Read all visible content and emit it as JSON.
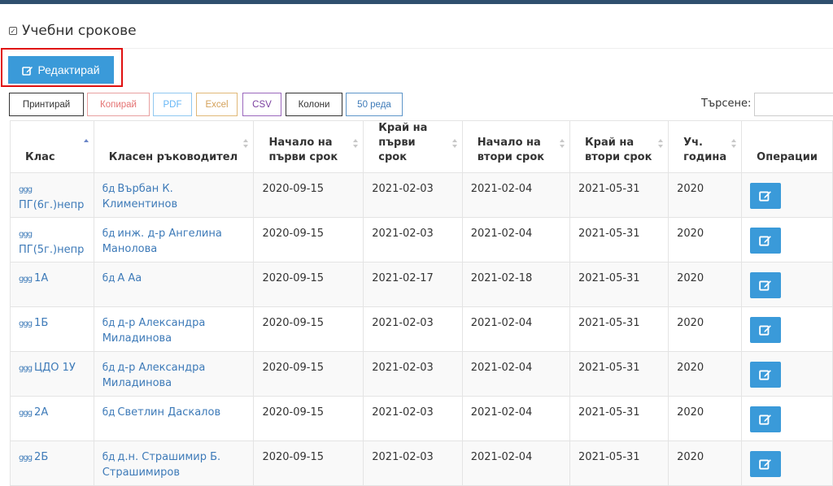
{
  "page_title": "Учебни срокове",
  "edit_button_label": "Редактирай",
  "exports": [
    {
      "label": "Принтирай",
      "color": "#333333",
      "border": "#333333"
    },
    {
      "label": "Копирай",
      "color": "#e57373",
      "border": "#e8a0a0"
    },
    {
      "label": "PDF",
      "color": "#64b5f6",
      "border": "#90c8f0"
    },
    {
      "label": "Excel",
      "color": "#d4a15a",
      "border": "#e0b878"
    },
    {
      "label": "CSV",
      "color": "#7b3fa0",
      "border": "#9b67bd"
    },
    {
      "label": "Колони",
      "color": "#333333",
      "border": "#333333"
    },
    {
      "label": "50 реда",
      "color": "#3d7ab8",
      "border": "#5d95c9"
    }
  ],
  "search": {
    "label": "Търсене:",
    "value": "",
    "placeholder": ""
  },
  "table": {
    "headers": [
      {
        "l1": "",
        "l2": "Клас",
        "sort": "asc"
      },
      {
        "l1": "",
        "l2": "Класен ръководител",
        "sort": "both"
      },
      {
        "l1": "Начало на",
        "l2": "първи срок",
        "sort": "both"
      },
      {
        "l1": "Край на",
        "l2": "първи срок",
        "sort": "both"
      },
      {
        "l1": "Начало на",
        "l2": "втори срок",
        "sort": "both"
      },
      {
        "l1": "Край на",
        "l2": "втори срок",
        "sort": "both"
      },
      {
        "l1": "Уч.",
        "l2": "година",
        "sort": "both"
      },
      {
        "l1": "",
        "l2": "Операции",
        "sort": "none"
      }
    ],
    "rows": [
      {
        "cls": "ПГ(6г.)непр",
        "teacher": "Върбан К. Климентинов",
        "s1_start": "2020-09-15",
        "s1_end": "2021-02-03",
        "s2_start": "2021-02-04",
        "s2_end": "2021-05-31",
        "year": "2020"
      },
      {
        "cls": "ПГ(5г.)непр",
        "teacher": "инж. д-р Ангелина Манолова",
        "s1_start": "2020-09-15",
        "s1_end": "2021-02-03",
        "s2_start": "2021-02-04",
        "s2_end": "2021-05-31",
        "year": "2020"
      },
      {
        "cls": "1А",
        "teacher": "А Аа",
        "s1_start": "2020-09-15",
        "s1_end": "2021-02-17",
        "s2_start": "2021-02-18",
        "s2_end": "2021-05-31",
        "year": "2020"
      },
      {
        "cls": "1Б",
        "teacher": "д-р Александра Миладинова",
        "s1_start": "2020-09-15",
        "s1_end": "2021-02-03",
        "s2_start": "2021-02-04",
        "s2_end": "2021-05-31",
        "year": "2020"
      },
      {
        "cls": "ЦДО 1У",
        "teacher": "д-р Александра Миладинова",
        "s1_start": "2020-09-15",
        "s1_end": "2021-02-03",
        "s2_start": "2021-02-04",
        "s2_end": "2021-05-31",
        "year": "2020"
      },
      {
        "cls": "2А",
        "teacher": "Светлин Даскалов",
        "s1_start": "2020-09-15",
        "s1_end": "2021-02-03",
        "s2_start": "2021-02-04",
        "s2_end": "2021-05-31",
        "year": "2020"
      },
      {
        "cls": "2Б",
        "teacher": "д.н. Страшимир Б. Страшимиров",
        "s1_start": "2020-09-15",
        "s1_end": "2021-02-03",
        "s2_start": "2021-02-04",
        "s2_end": "2021-05-31",
        "year": "2020"
      }
    ]
  },
  "icons": {
    "title": "calendar-check-icon",
    "edit": "edit-square-icon",
    "class": "group-icon",
    "teacher": "teacher-glasses-icon",
    "row_op": "edit-square-icon"
  },
  "colors": {
    "accent": "#3a9ad9",
    "link": "#3d7ab8",
    "highlight": "#e01010",
    "topbar": "#2f4f6e"
  }
}
